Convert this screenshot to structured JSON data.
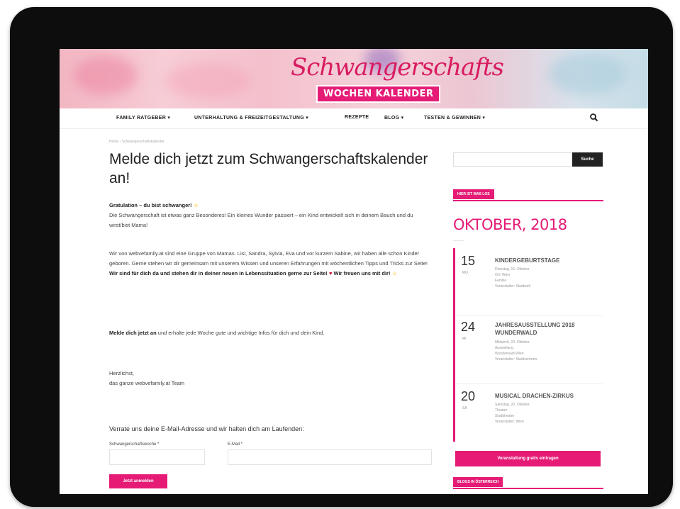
{
  "header": {
    "logo_script": "Schwangerschafts",
    "logo_box": "WOCHEN KALENDER"
  },
  "nav": {
    "items": [
      "FAMILY RATGEBER ▾",
      "UNTERHALTUNG & FREIZEITGESTALTUNG ▾",
      "REZEPTE",
      "BLOG ▾",
      "TESTEN & GEWINNEN ▾"
    ],
    "search_icon": "search-icon"
  },
  "main": {
    "breadcrumb": "Home › Schwangerschaftskalender",
    "title": "Melde dich jetzt zum Schwangerschaftskalender an!",
    "congrats_bold": "Gratulation – du bist schwanger!",
    "congrats_text": "Die Schwangerschaft ist etwas ganz Besonderes! Ein kleines Wunder passiert – ein Kind entwickelt sich in deinem Bauch und du wirst/bist Mama!",
    "about_text": "Wir von webvefamily.at sind eine Gruppe von Mamas. Lisi, Sandra, Sylvia, Eva und vor kurzem Sabine, wir haben alle schon Kinder geboren. Gerne stehen wir dir gemeinsam mit unserem Wissen und unseren Erfahrungen mit wöchentlichen Tipps und Tricks zur Seite!",
    "support_bold_1": "Wir sind für dich da und stehen dir in deiner neuen in Lebenssituation gerne zur Seite!",
    "support_bold_2": "Wir freuen uns mit dir!",
    "signup_bold": "Melde dich jetzt an",
    "signup_text": "und erhalte jede Woche gute und wichtige Infos für dich und dein Kind.",
    "greeting_1": "Herzlichst,",
    "greeting_2": "das ganze webvefamily.at Team",
    "form_intro": "Verrate uns deine E-Mail-Adresse und wir halten dich am Laufenden:",
    "label_week": "Schwangerschaftswoche *",
    "label_email": "E-Mail *",
    "submit_label": "Jetzt anmelden"
  },
  "sidebar": {
    "search_button": "Suche",
    "widget_tag": "HIER IST WAS LOS",
    "month": "OKTOBER, 2018",
    "events": [
      {
        "day": "15",
        "weekday": "MO",
        "title": "KINDERGEBURTSTAGE",
        "meta": [
          "Dienstag, 15. Oktober",
          "Ort: Wien",
          "Familie",
          "Veranstalter: Stadtwelt"
        ]
      },
      {
        "day": "24",
        "weekday": "MI",
        "title": "JAHRESAUSSTELLUNG 2018 WUNDERWALD",
        "meta": [
          "Mittwoch, 24. Oktober",
          "Ausstellung",
          "Wunderwald Wien",
          "Veranstalter: Stadtzentrum"
        ]
      },
      {
        "day": "20",
        "weekday": "SA",
        "title": "MUSICAL DRACHEN-ZIRKUS",
        "meta": [
          "Samstag, 20. Oktober",
          "Theater",
          "Stadttheater",
          "Veranstalter: Wien"
        ]
      }
    ],
    "cta_label": "Veranstaltung gratis eintragen",
    "widget_tag_2": "BLOGS IN ÖSTERREICH"
  },
  "colors": {
    "accent": "#e51b76",
    "frame": "#0d0d0d"
  }
}
